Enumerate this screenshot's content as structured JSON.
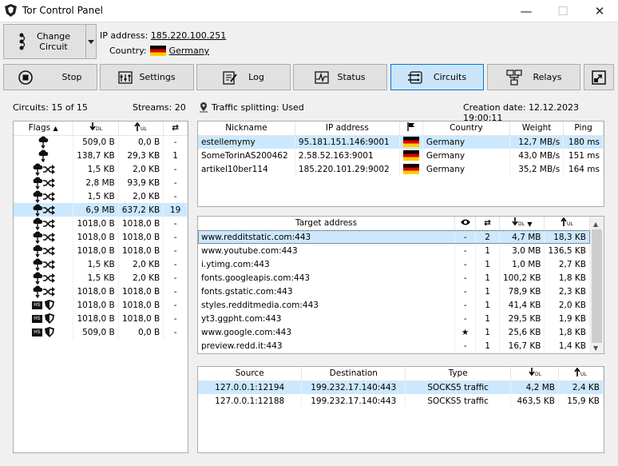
{
  "window": {
    "title": "Tor Control Panel"
  },
  "top": {
    "change_circuit": "Change\nCircuit",
    "ip_label": "IP address:",
    "ip_value": "185.220.100.251",
    "country_label": "Country:",
    "country_value": "Germany"
  },
  "toolbar": {
    "stop": "Stop",
    "settings": "Settings",
    "log": "Log",
    "status": "Status",
    "circuits": "Circuits",
    "relays": "Relays"
  },
  "info": {
    "circuits": "Circuits: 15 of 15",
    "streams": "Streams: 20",
    "traffic": "Traffic splitting: Used",
    "creation": "Creation date: 12.12.2023 19:00:11"
  },
  "circuits_table": {
    "headers": [
      "Flags",
      "DL",
      "UL",
      "⇄"
    ],
    "rows": [
      {
        "flags": "exit",
        "dl": "509,0 B",
        "ul": "0,0 B",
        "n": "-"
      },
      {
        "flags": "exit",
        "dl": "138,7 KB",
        "ul": "29,3 KB",
        "n": "1"
      },
      {
        "flags": "exit-split",
        "dl": "1,5 KB",
        "ul": "2,0 KB",
        "n": "-"
      },
      {
        "flags": "exit-split",
        "dl": "2,8 MB",
        "ul": "93,9 KB",
        "n": "-"
      },
      {
        "flags": "exit-split",
        "dl": "1,5 KB",
        "ul": "2,0 KB",
        "n": "-"
      },
      {
        "flags": "exit-split",
        "dl": "6,9 MB",
        "ul": "637,2 KB",
        "n": "19",
        "selected": true
      },
      {
        "flags": "exit-split",
        "dl": "1018,0 B",
        "ul": "1018,0 B",
        "n": "-"
      },
      {
        "flags": "exit-split",
        "dl": "1018,0 B",
        "ul": "1018,0 B",
        "n": "-"
      },
      {
        "flags": "exit-split",
        "dl": "1018,0 B",
        "ul": "1018,0 B",
        "n": "-"
      },
      {
        "flags": "exit-split",
        "dl": "1,5 KB",
        "ul": "2,0 KB",
        "n": "-"
      },
      {
        "flags": "exit-split",
        "dl": "1,5 KB",
        "ul": "2,0 KB",
        "n": "-"
      },
      {
        "flags": "exit-split",
        "dl": "1018,0 B",
        "ul": "1018,0 B",
        "n": "-"
      },
      {
        "flags": "hs",
        "dl": "1018,0 B",
        "ul": "1018,0 B",
        "n": "-"
      },
      {
        "flags": "hs",
        "dl": "1018,0 B",
        "ul": "1018,0 B",
        "n": "-"
      },
      {
        "flags": "hs",
        "dl": "509,0 B",
        "ul": "0,0 B",
        "n": "-"
      }
    ]
  },
  "nodes_table": {
    "headers": [
      "Nickname",
      "IP address",
      "Country",
      "Weight",
      "Ping"
    ],
    "rows": [
      {
        "nick": "estellemymy",
        "ip": "95.181.151.146:9001",
        "country": "Germany",
        "weight": "12,7 MB/s",
        "ping": "180 ms",
        "selected": true
      },
      {
        "nick": "SomeTorinAS200462",
        "ip": "2.58.52.163:9001",
        "country": "Germany",
        "weight": "43,0 MB/s",
        "ping": "151 ms"
      },
      {
        "nick": "artikel10ber114",
        "ip": "185.220.101.29:9002",
        "country": "Germany",
        "weight": "35,2 MB/s",
        "ping": "164 ms"
      }
    ]
  },
  "streams_table": {
    "headers": [
      "Target address",
      "DL",
      "UL"
    ],
    "rows": [
      {
        "addr": "www.redditstatic.com:443",
        "eye": "-",
        "n": "2",
        "dl": "4,7 MB",
        "ul": "18,3 KB",
        "selected": true
      },
      {
        "addr": "www.youtube.com:443",
        "eye": "-",
        "n": "1",
        "dl": "3,0 MB",
        "ul": "136,5 KB"
      },
      {
        "addr": "i.ytimg.com:443",
        "eye": "-",
        "n": "1",
        "dl": "1,0 MB",
        "ul": "2,7 KB"
      },
      {
        "addr": "fonts.googleapis.com:443",
        "eye": "-",
        "n": "1",
        "dl": "100,2 KB",
        "ul": "1,8 KB"
      },
      {
        "addr": "fonts.gstatic.com:443",
        "eye": "-",
        "n": "1",
        "dl": "78,9 KB",
        "ul": "2,3 KB"
      },
      {
        "addr": "styles.redditmedia.com:443",
        "eye": "-",
        "n": "1",
        "dl": "41,4 KB",
        "ul": "2,0 KB"
      },
      {
        "addr": "yt3.ggpht.com:443",
        "eye": "-",
        "n": "1",
        "dl": "29,5 KB",
        "ul": "1,9 KB"
      },
      {
        "addr": "www.google.com:443",
        "eye": "★",
        "n": "1",
        "dl": "25,6 KB",
        "ul": "1,8 KB"
      },
      {
        "addr": "preview.redd.it:443",
        "eye": "-",
        "n": "1",
        "dl": "16,7 KB",
        "ul": "1,4 KB"
      }
    ]
  },
  "conn_table": {
    "headers": [
      "Source",
      "Destination",
      "Type",
      "DL",
      "UL"
    ],
    "rows": [
      {
        "src": "127.0.0.1:12194",
        "dst": "199.232.17.140:443",
        "type": "SOCKS5 traffic",
        "dl": "4,2 MB",
        "ul": "2,4 KB",
        "selected": true
      },
      {
        "src": "127.0.0.1:12188",
        "dst": "199.232.17.140:443",
        "type": "SOCKS5 traffic",
        "dl": "463,5 KB",
        "ul": "15,9 KB"
      }
    ]
  }
}
